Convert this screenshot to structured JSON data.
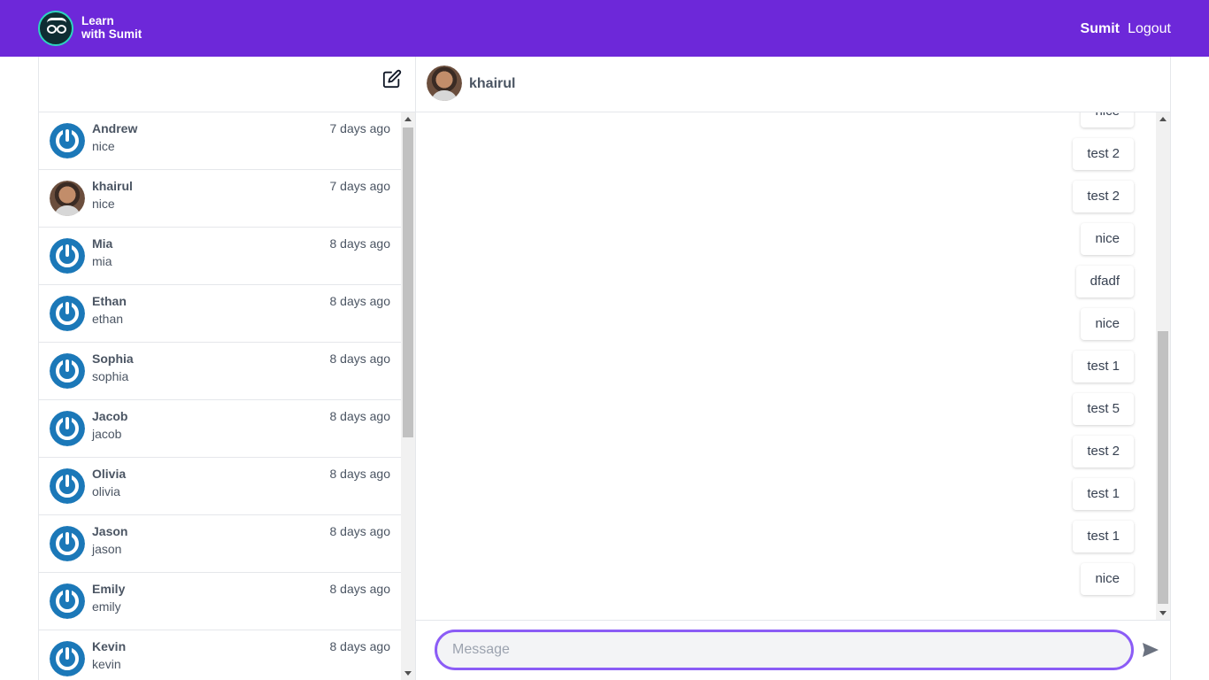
{
  "header": {
    "brand_line1": "Learn",
    "brand_line2": "with Sumit",
    "user": "Sumit",
    "logout": "Logout",
    "bg_color": "#6d28d9"
  },
  "sidebar": {
    "compose_icon": "edit-icon",
    "conversations": [
      {
        "name": "Andrew",
        "time": "7 days ago",
        "message": "nice",
        "avatar": "power-icon"
      },
      {
        "name": "khairul",
        "time": "7 days ago",
        "message": "nice",
        "avatar": "photo"
      },
      {
        "name": "Mia",
        "time": "8 days ago",
        "message": "mia",
        "avatar": "power-icon"
      },
      {
        "name": "Ethan",
        "time": "8 days ago",
        "message": "ethan",
        "avatar": "power-icon"
      },
      {
        "name": "Sophia",
        "time": "8 days ago",
        "message": "sophia",
        "avatar": "power-icon"
      },
      {
        "name": "Jacob",
        "time": "8 days ago",
        "message": "jacob",
        "avatar": "power-icon"
      },
      {
        "name": "Olivia",
        "time": "8 days ago",
        "message": "olivia",
        "avatar": "power-icon"
      },
      {
        "name": "Jason",
        "time": "8 days ago",
        "message": "jason",
        "avatar": "power-icon"
      },
      {
        "name": "Emily",
        "time": "8 days ago",
        "message": "emily",
        "avatar": "power-icon"
      },
      {
        "name": "Kevin",
        "time": "8 days ago",
        "message": "kevin",
        "avatar": "power-icon"
      }
    ]
  },
  "chat": {
    "name": "khairul",
    "messages": [
      "nice",
      "test 2",
      "test 2",
      "nice",
      "dfadf",
      "nice",
      "test 1",
      "test 5",
      "test 2",
      "test 1",
      "test 1",
      "nice"
    ],
    "input_placeholder": "Message",
    "send_icon": "send-icon"
  }
}
